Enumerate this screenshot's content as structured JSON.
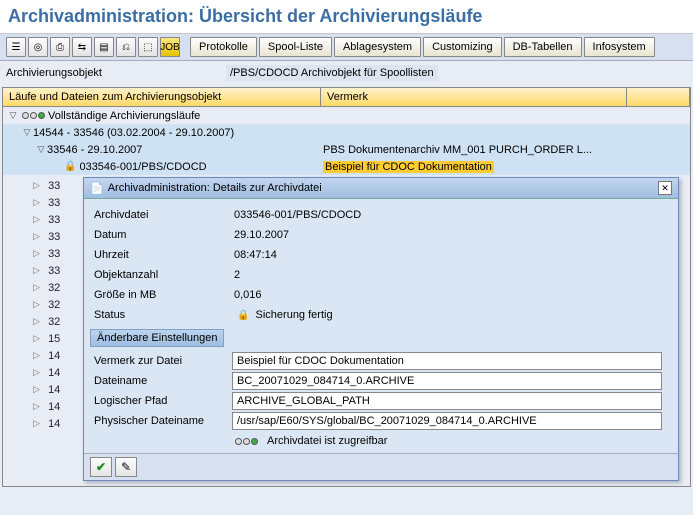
{
  "title": "Archivadministration: Übersicht der Archivierungsläufe",
  "toolbar": {
    "icons": [
      "☰",
      "◎",
      "⎙",
      "⇆",
      "▤",
      "⎌",
      "⬚",
      "JOB"
    ],
    "buttons": [
      "Protokolle",
      "Spool-Liste",
      "Ablagesystem",
      "Customizing",
      "DB-Tabellen",
      "Infosystem"
    ]
  },
  "obj": {
    "label": "Archivierungsobjekt",
    "value": "/PBS/CDOCD Archivobjekt für Spoollisten"
  },
  "grid": {
    "h1": "Läufe und Dateien zum Archivierungsobjekt",
    "h2": "Vermerk",
    "h3": ""
  },
  "tree": {
    "root": "Vollständige Archivierungsläufe",
    "l1": "14544 - 33546 (03.02.2004 - 29.10.2007)",
    "l2": "33546 - 29.10.2007",
    "l2_vm": "PBS Dokumentenarchiv MM_001 PURCH_ORDER L...",
    "l3": "033546-001/PBS/CDOCD",
    "l3_vm": "Beispiel für CDOC Dokumentation",
    "rest": [
      "33",
      "33",
      "33",
      "33",
      "33",
      "33",
      "32",
      "32",
      "32",
      "15",
      "14",
      "14",
      "14",
      "14",
      "14"
    ]
  },
  "dlg": {
    "title": "Archivadministration: Details zur Archivdatei",
    "rows": {
      "archivdatei_l": "Archivdatei",
      "archivdatei_v": "033546-001/PBS/CDOCD",
      "datum_l": "Datum",
      "datum_v": "29.10.2007",
      "uhrzeit_l": "Uhrzeit",
      "uhrzeit_v": "08:47:14",
      "objektanzahl_l": "Objektanzahl",
      "objektanzahl_v": "2",
      "groesse_l": "Größe in MB",
      "groesse_v": "0,016",
      "status_l": "Status",
      "status_v": "Sicherung fertig"
    },
    "subhead": "Änderbare Einstellungen",
    "edit": {
      "vermerk_l": "Vermerk zur Datei",
      "vermerk_v": "Beispiel für CDOC Dokumentation",
      "dateiname_l": "Dateiname",
      "dateiname_v": "BC_20071029_084714_0.ARCHIVE",
      "lpfad_l": "Logischer Pfad",
      "lpfad_v": "ARCHIVE_GLOBAL_PATH",
      "pfad_l": "Physischer Dateiname",
      "pfad_v": "/usr/sap/E60/SYS/global/BC_20071029_084714_0.ARCHIVE"
    },
    "status_text": "Archivdatei ist zugreifbar"
  }
}
